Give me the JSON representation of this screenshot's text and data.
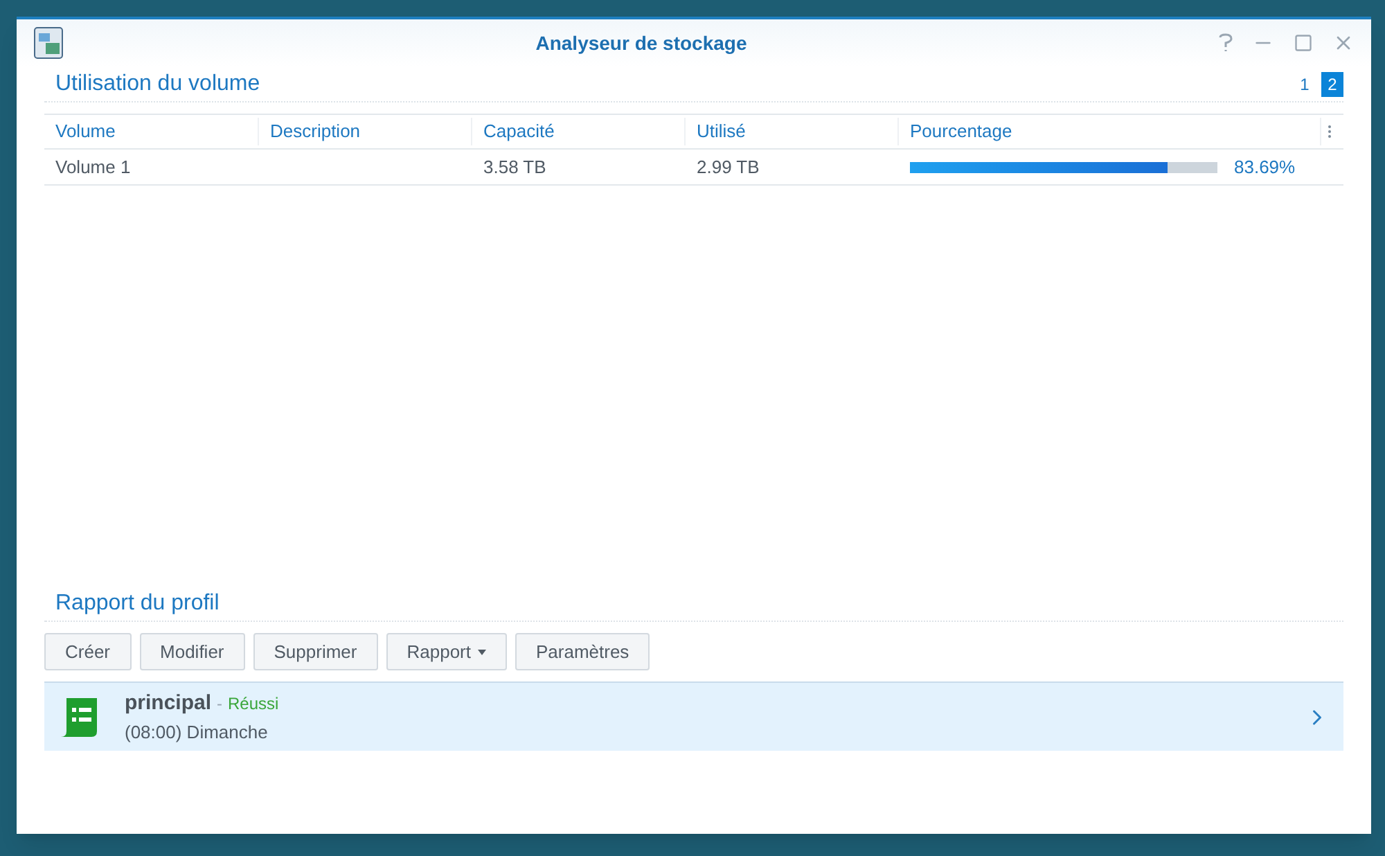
{
  "window": {
    "title": "Analyseur de stockage"
  },
  "volume_section": {
    "title": "Utilisation du volume",
    "pages": [
      {
        "label": "1",
        "selected": false
      },
      {
        "label": "2",
        "selected": true
      }
    ],
    "table": {
      "columns": [
        "Volume",
        "Description",
        "Capacité",
        "Utilisé",
        "Pourcentage"
      ],
      "rows": [
        {
          "volume": "Volume 1",
          "description": "",
          "capacity": "3.58 TB",
          "used": "2.99 TB",
          "level": 0.8369,
          "percentage": "83.69%"
        }
      ]
    }
  },
  "profile_section": {
    "title": "Rapport du profil",
    "buttons": [
      {
        "label": "Créer",
        "dropdown": false
      },
      {
        "label": "Modifier",
        "dropdown": false
      },
      {
        "label": "Supprimer",
        "dropdown": false
      },
      {
        "label": "Rapport",
        "dropdown": true
      },
      {
        "label": "Paramètres",
        "dropdown": false
      }
    ],
    "profiles": [
      {
        "name": "principal",
        "separator": "-",
        "status": "Réussi",
        "schedule": "(08:00) Dimanche",
        "selected": true
      }
    ]
  }
}
